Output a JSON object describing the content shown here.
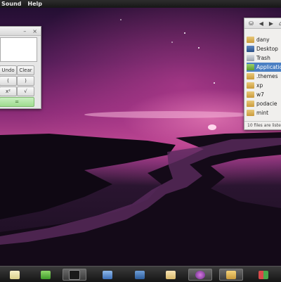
{
  "top_panel": {
    "menus": [
      "Sound",
      "Help"
    ]
  },
  "calculator": {
    "window_controls": [
      "–",
      "×"
    ],
    "buttons": {
      "undo": "Undo",
      "clear": "Clear",
      "paren_open": "(",
      "paren_close": ")",
      "square": "x²",
      "sqrt": "√",
      "equals": "="
    }
  },
  "file_manager": {
    "toolbar_icons": [
      "drives-icon",
      "back-arrow-icon",
      "forward-arrow-icon",
      "home-icon"
    ],
    "items": [
      {
        "label": "dany",
        "icon": "home-folder-icon"
      },
      {
        "label": "Desktop",
        "icon": "desktop-icon"
      },
      {
        "label": "Trash",
        "icon": "trash-icon"
      },
      {
        "label": "Applications",
        "icon": "applications-icon",
        "selected": true
      },
      {
        "label": ".themes",
        "icon": "folder-icon"
      },
      {
        "label": "xp",
        "icon": "folder-icon"
      },
      {
        "label": "w7",
        "icon": "folder-icon"
      },
      {
        "label": "podacie",
        "icon": "folder-icon"
      },
      {
        "label": "mint",
        "icon": "folder-icon"
      }
    ],
    "status": "10 files are liste"
  },
  "dock": {
    "items": [
      "text-editor-icon",
      "green-app-icon",
      "terminal-icon",
      "network-icon",
      "monitor-icon",
      "mail-icon",
      "media-player-icon",
      "file-manager-icon",
      "color-icon"
    ]
  },
  "colors": {
    "selection": "#4a7fc3",
    "panel": "#161616",
    "sky_magenta": "#b8478f"
  }
}
